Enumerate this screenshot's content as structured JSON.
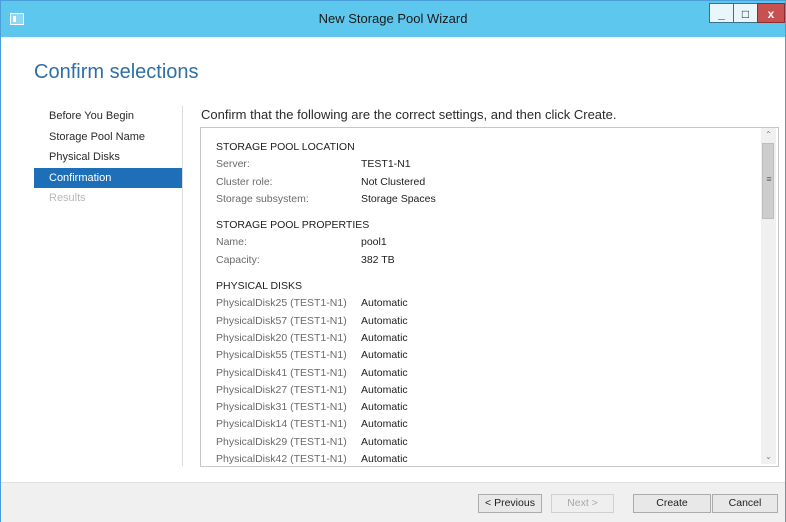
{
  "window": {
    "title": "New Storage Pool Wizard"
  },
  "title_controls": {
    "minimize": "_",
    "maximize": "□",
    "close": "x"
  },
  "page": {
    "title": "Confirm selections",
    "heading": "Confirm that the following are the correct settings, and then click Create."
  },
  "nav": {
    "items": [
      {
        "label": "Before You Begin",
        "state": "normal"
      },
      {
        "label": "Storage Pool Name",
        "state": "normal"
      },
      {
        "label": "Physical Disks",
        "state": "normal"
      },
      {
        "label": "Confirmation",
        "state": "active"
      },
      {
        "label": "Results",
        "state": "disabled"
      }
    ]
  },
  "sections": {
    "location": {
      "header": "STORAGE POOL LOCATION",
      "rows": [
        {
          "label": "Server:",
          "value": "TEST1-N1"
        },
        {
          "label": "Cluster role:",
          "value": "Not Clustered"
        },
        {
          "label": "Storage subsystem:",
          "value": "Storage Spaces"
        }
      ]
    },
    "properties": {
      "header": "STORAGE POOL PROPERTIES",
      "rows": [
        {
          "label": "Name:",
          "value": "pool1"
        },
        {
          "label": "Capacity:",
          "value": "382 TB"
        }
      ]
    },
    "disks": {
      "header": "PHYSICAL DISKS",
      "rows": [
        {
          "label": "PhysicalDisk25 (TEST1-N1)",
          "value": "Automatic"
        },
        {
          "label": "PhysicalDisk57 (TEST1-N1)",
          "value": "Automatic"
        },
        {
          "label": "PhysicalDisk20 (TEST1-N1)",
          "value": "Automatic"
        },
        {
          "label": "PhysicalDisk55 (TEST1-N1)",
          "value": "Automatic"
        },
        {
          "label": "PhysicalDisk41 (TEST1-N1)",
          "value": "Automatic"
        },
        {
          "label": "PhysicalDisk27 (TEST1-N1)",
          "value": "Automatic"
        },
        {
          "label": "PhysicalDisk31 (TEST1-N1)",
          "value": "Automatic"
        },
        {
          "label": "PhysicalDisk14 (TEST1-N1)",
          "value": "Automatic"
        },
        {
          "label": "PhysicalDisk29 (TEST1-N1)",
          "value": "Automatic"
        },
        {
          "label": "PhysicalDisk42 (TEST1-N1)",
          "value": "Automatic"
        }
      ]
    }
  },
  "scrollbar": {
    "up_arrow": "⌃",
    "down_arrow": "⌄",
    "grip": "≡"
  },
  "buttons": {
    "previous": "< Previous",
    "next": "Next >",
    "create": "Create",
    "cancel": "Cancel"
  },
  "colors": {
    "titlebar": "#5ec7ee",
    "accent": "#1d6fb8",
    "page_title": "#2f6fa6",
    "close_button": "#c75050"
  }
}
